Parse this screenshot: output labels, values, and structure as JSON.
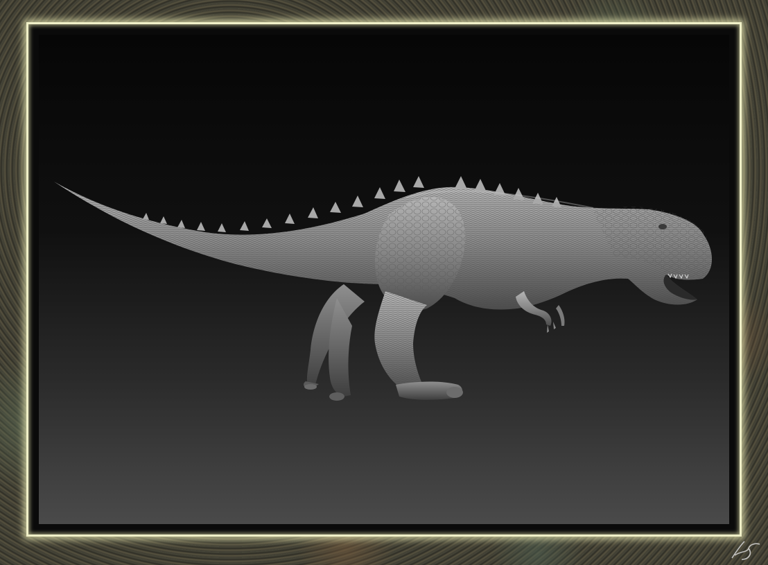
{
  "image": {
    "subject": "dinosaur-sculpt",
    "colors": {
      "frame_glow": "#f0f0c8",
      "stone": "#3c3b31",
      "background_top": "#060606",
      "background_bottom": "#4a4a4a",
      "sculpt_base": "#8a8a8a"
    }
  }
}
